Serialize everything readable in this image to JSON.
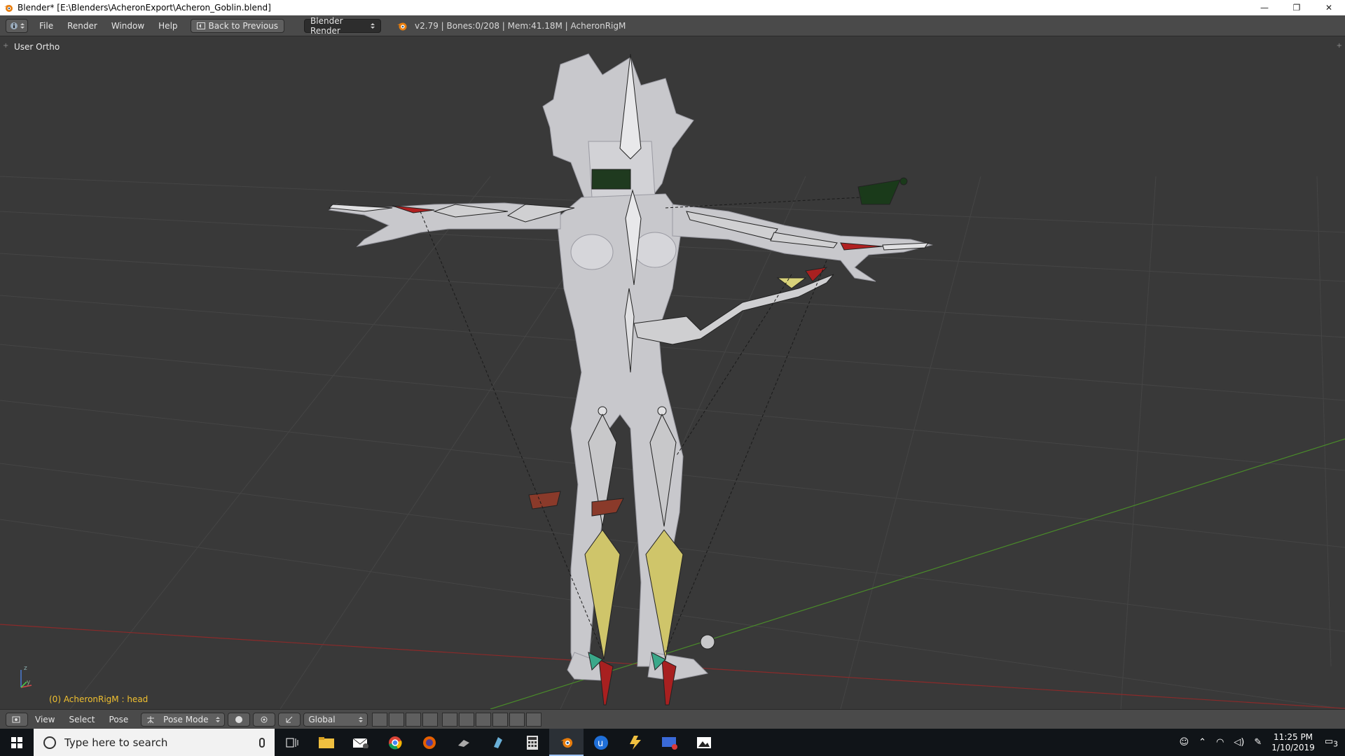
{
  "window": {
    "title": "Blender* [E:\\Blenders\\AcheronExport\\Acheron_Goblin.blend]",
    "minimize_glyph": "—",
    "restore_glyph": "❐",
    "close_glyph": "✕"
  },
  "info_header": {
    "menus": [
      "File",
      "Render",
      "Window",
      "Help"
    ],
    "back_button": "Back to Previous",
    "render_engine": "Blender Render",
    "stats": "v2.79 | Bones:0/208 | Mem:41.18M | AcheronRigM"
  },
  "viewport": {
    "view_label": "User Ortho",
    "active_object": "(0) AcheronRigM : head",
    "background_color": "#393939",
    "grid_color": "#4a4a4a",
    "x_axis_color": "#8b2a2a",
    "y_axis_color": "#4a8b2a"
  },
  "footer": {
    "menus": [
      "View",
      "Select",
      "Pose"
    ],
    "mode": "Pose Mode",
    "orientation": "Global"
  },
  "taskbar": {
    "search_placeholder": "Type here to search",
    "apps": [
      "task-view",
      "file-explorer",
      "mail",
      "chrome",
      "firefox",
      "app",
      "app",
      "calculator",
      "blender",
      "app",
      "app",
      "app",
      "photos"
    ],
    "time": "11:25 PM",
    "date": "1/10/2019",
    "notification_count": "3",
    "mail_badge": "2"
  },
  "icons": {
    "blender": "blender-icon",
    "windows": "windows-start-icon"
  }
}
